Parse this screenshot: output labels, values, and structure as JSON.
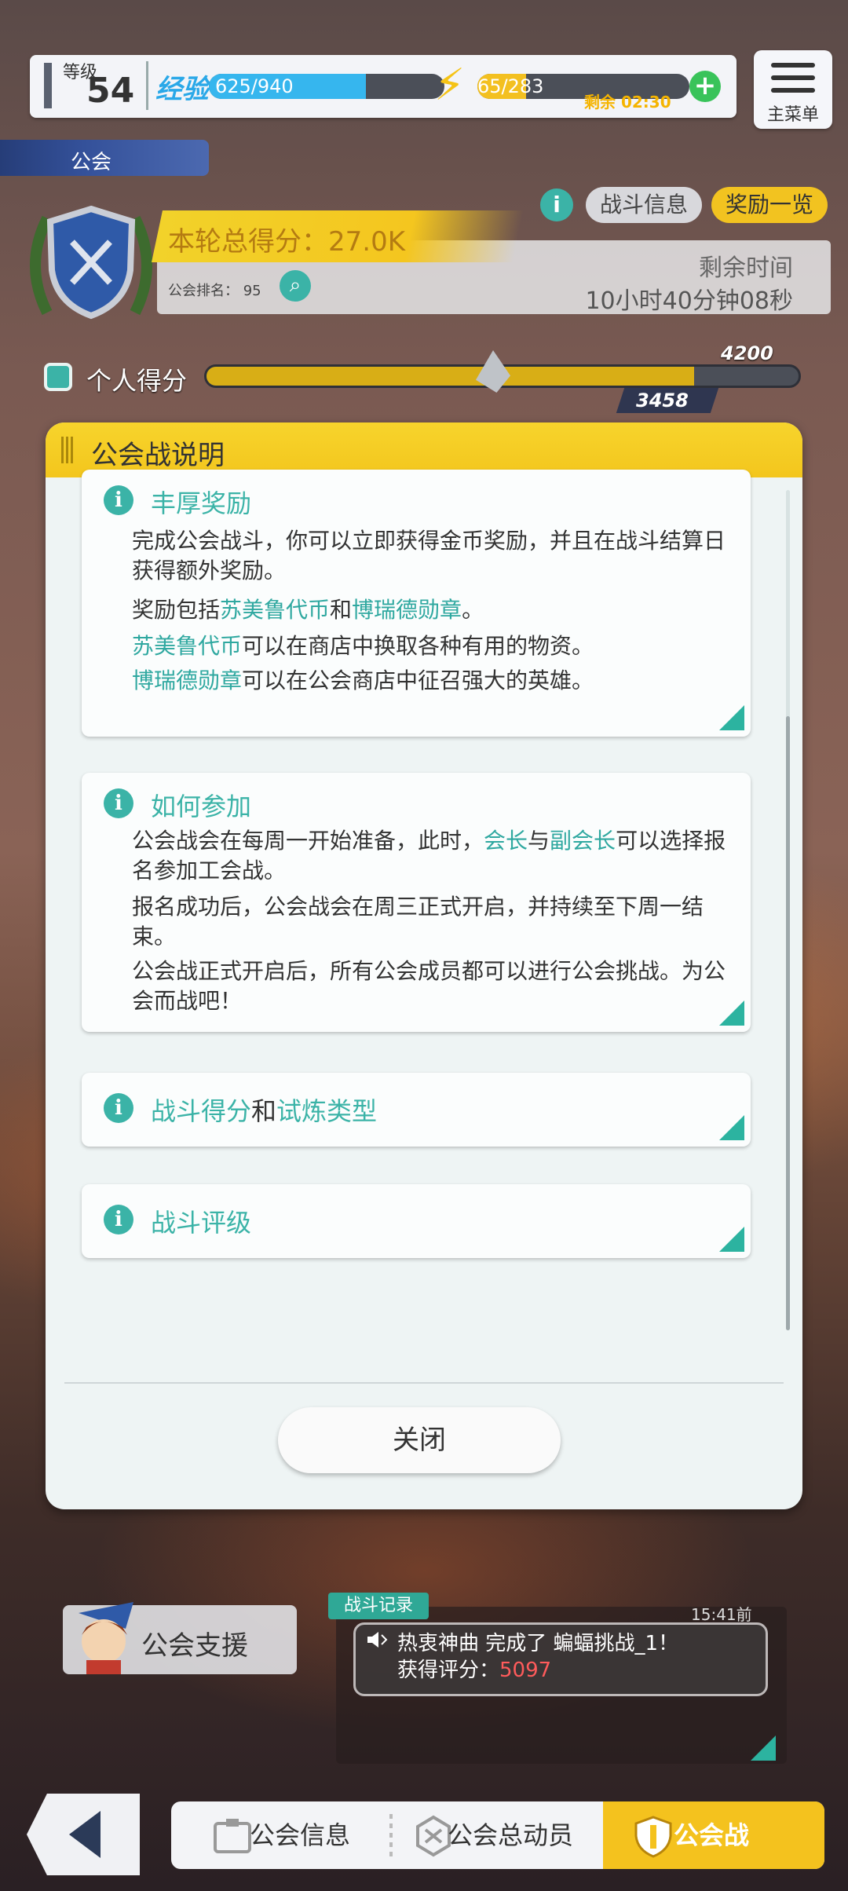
{
  "header": {
    "level_label": "等级",
    "level_value": "54",
    "exp_label": "经验",
    "exp_text": "625/940",
    "exp_fraction": 0.665,
    "energy_current": "65",
    "energy_max": "/283",
    "energy_fraction": 0.23,
    "energy_remaining": "剩余 02:30",
    "menu_label": "主菜单"
  },
  "guild": {
    "tag": "公会",
    "score_label": "本轮总得分：27.0K",
    "rank_label": "公会排名：",
    "rank_value": "95",
    "remaining_label": "剩余时间",
    "remaining_value": "10小时40分钟08秒",
    "battle_info_btn": "战斗信息",
    "rewards_btn": "奖励一览"
  },
  "personal": {
    "label": "个人得分",
    "goal": "4200",
    "current": "3458",
    "fraction": 0.823
  },
  "modal": {
    "title": "公会战说明",
    "close": "关闭",
    "sections": {
      "rewards": {
        "title": "丰厚奖励",
        "p1": "完成公会战斗，你可以立即获得金币奖励，并且在战斗结算日获得额外奖励。",
        "p2_pre": "奖励包括",
        "p2_hl1": "苏美鲁代币",
        "p2_mid": "和",
        "p2_hl2": "博瑞德勋章",
        "p2_post": "。",
        "p3_hl": "苏美鲁代币",
        "p3_text": "可以在商店中换取各种有用的物资。",
        "p4_hl": "博瑞德勋章",
        "p4_text": "可以在公会商店中征召强大的英雄。"
      },
      "join": {
        "title": "如何参加",
        "p1_pre": "公会战会在每周一开始准备，此时，",
        "p1_hl1": "会长",
        "p1_mid": "与",
        "p1_hl2": "副会长",
        "p1_post": "可以选择报名参加工会战。",
        "p2": "报名成功后，公会战会在周三正式开启，并持续至下周一结束。",
        "p3": "公会战正式开启后，所有公会成员都可以进行公会挑战。为公会而战吧！"
      },
      "score": {
        "title_hl1": "战斗得分",
        "title_mid": "和",
        "title_hl2": "试炼类型"
      },
      "grading": {
        "title": "战斗评级"
      }
    }
  },
  "bottom": {
    "support_label": "公会支援",
    "log_tag": "战斗记录",
    "log_time": "15:41前",
    "log_line1": "热衷神曲 完成了 蝙蝠挑战_1！",
    "log_line2_label": "获得评分：",
    "log_line2_value": "5097",
    "tabs": [
      "公会信息",
      "公会总动员",
      "公会战"
    ]
  }
}
